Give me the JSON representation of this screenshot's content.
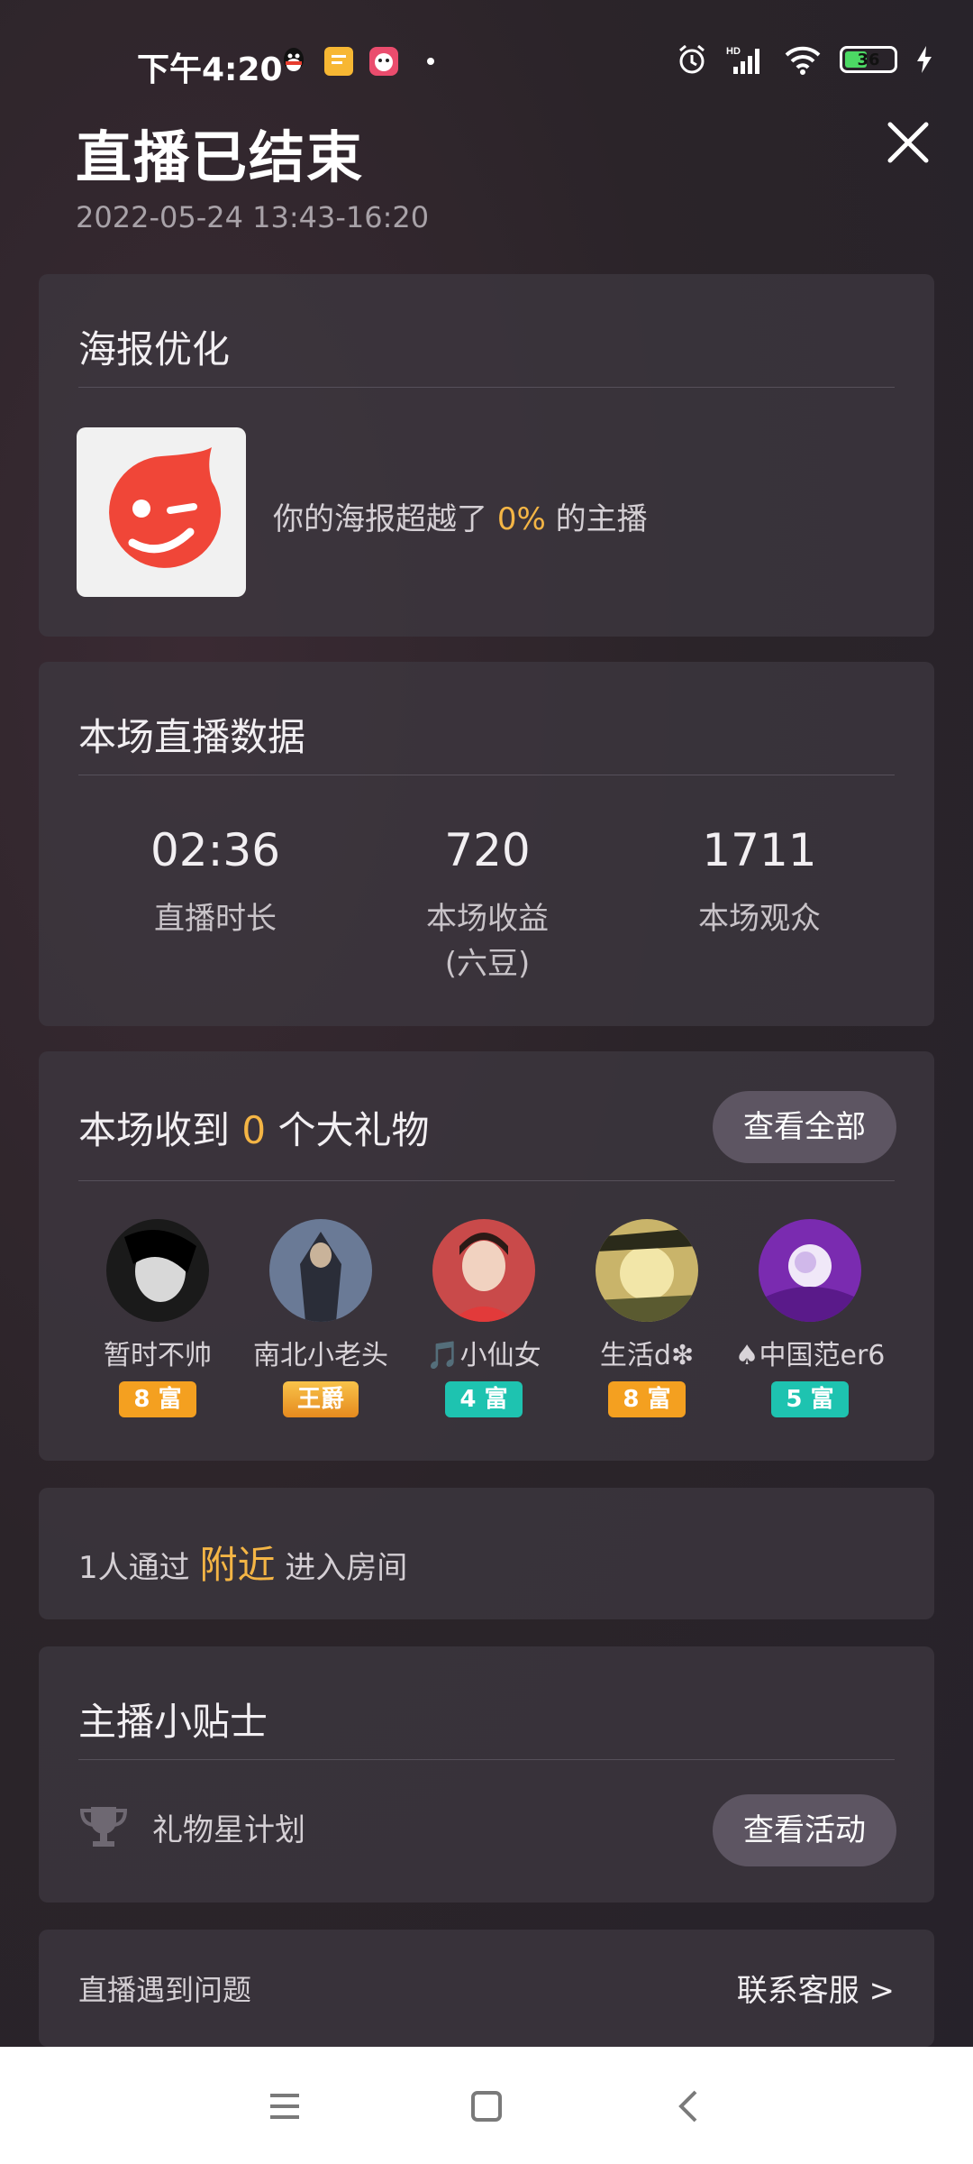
{
  "status_bar": {
    "time": "下午4:20",
    "battery": "36",
    "icons": [
      "qq-icon",
      "notes-icon",
      "app-icon",
      "alarm-icon",
      "hd-signal-icon",
      "wifi-icon",
      "battery-icon",
      "charging-icon"
    ]
  },
  "header": {
    "title": "直播已结束",
    "subtitle": "2022-05-24 13:43-16:20"
  },
  "poster": {
    "title": "海报优化",
    "text_before": "你的海报超越了",
    "percent": "0%",
    "text_after": "的主播"
  },
  "stats": {
    "title": "本场直播数据",
    "items": [
      {
        "value": "02:36",
        "label": "直播时长",
        "sub": ""
      },
      {
        "value": "720",
        "label": "本场收益",
        "sub": "(六豆)"
      },
      {
        "value": "1711",
        "label": "本场观众",
        "sub": ""
      }
    ]
  },
  "gifts": {
    "title_before": "本场收到",
    "count": "0",
    "title_after": "个大礼物",
    "view_all": "查看全部",
    "gifters": [
      {
        "name": "暂时不帅",
        "badge": "8 富",
        "badge_color": "#f4a020"
      },
      {
        "name": "南北小老头",
        "badge": "王爵",
        "badge_color": "#f0a030"
      },
      {
        "name": "🎵小仙女",
        "badge": "4 富",
        "badge_color": "#1ec3b0"
      },
      {
        "name": "生活d❇",
        "badge": "8 富",
        "badge_color": "#f4a020"
      },
      {
        "name": "♠中国范er6",
        "badge": "5 富",
        "badge_color": "#1ec3b0"
      }
    ]
  },
  "nearby": {
    "text_before": "1人通过",
    "highlight": "附近",
    "text_after": "进入房间"
  },
  "tips": {
    "title": "主播小贴士",
    "item_label": "礼物星计划",
    "button": "查看活动"
  },
  "problem": {
    "text": "直播遇到问题",
    "link": "联系客服 >"
  },
  "colors": {
    "accent": "#f4b545",
    "card_bg": "#3e3840"
  }
}
